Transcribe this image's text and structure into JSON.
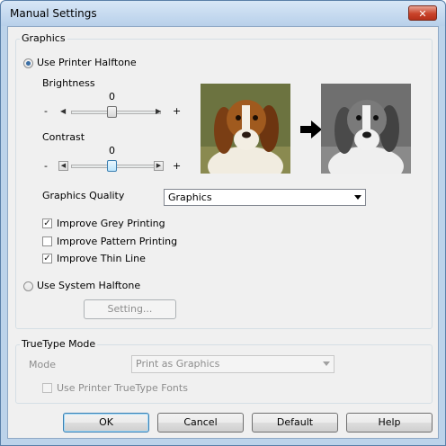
{
  "window": {
    "title": "Manual Settings",
    "close_glyph": "✕"
  },
  "graphics": {
    "legend": "Graphics",
    "use_printer_halftone": {
      "label": "Use Printer Halftone",
      "selected": true
    },
    "brightness": {
      "label": "Brightness",
      "value": "0",
      "min_sign": "-",
      "max_sign": "+"
    },
    "contrast": {
      "label": "Contrast",
      "value": "0",
      "min_sign": "-",
      "max_sign": "+"
    },
    "quality": {
      "label": "Graphics Quality",
      "selected": "Graphics"
    },
    "checkboxes": [
      {
        "label": "Improve Grey Printing",
        "checked": true,
        "mark": "✓"
      },
      {
        "label": "Improve Pattern Printing",
        "checked": false,
        "mark": ""
      },
      {
        "label": "Improve Thin Line",
        "checked": true,
        "mark": "✓"
      }
    ],
    "use_system_halftone": {
      "label": "Use System Halftone",
      "selected": false
    },
    "setting_button": "Setting..."
  },
  "truetype": {
    "legend": "TrueType Mode",
    "mode_label": "Mode",
    "mode_value": "Print as Graphics",
    "use_truetype_fonts": "Use Printer TrueType Fonts"
  },
  "buttons": {
    "ok": "OK",
    "cancel": "Cancel",
    "default": "Default",
    "help": "Help"
  },
  "colors": {
    "accent": "#3a6ea5",
    "window_frame": "#bcd3ea",
    "face": "#f0f0f0"
  }
}
